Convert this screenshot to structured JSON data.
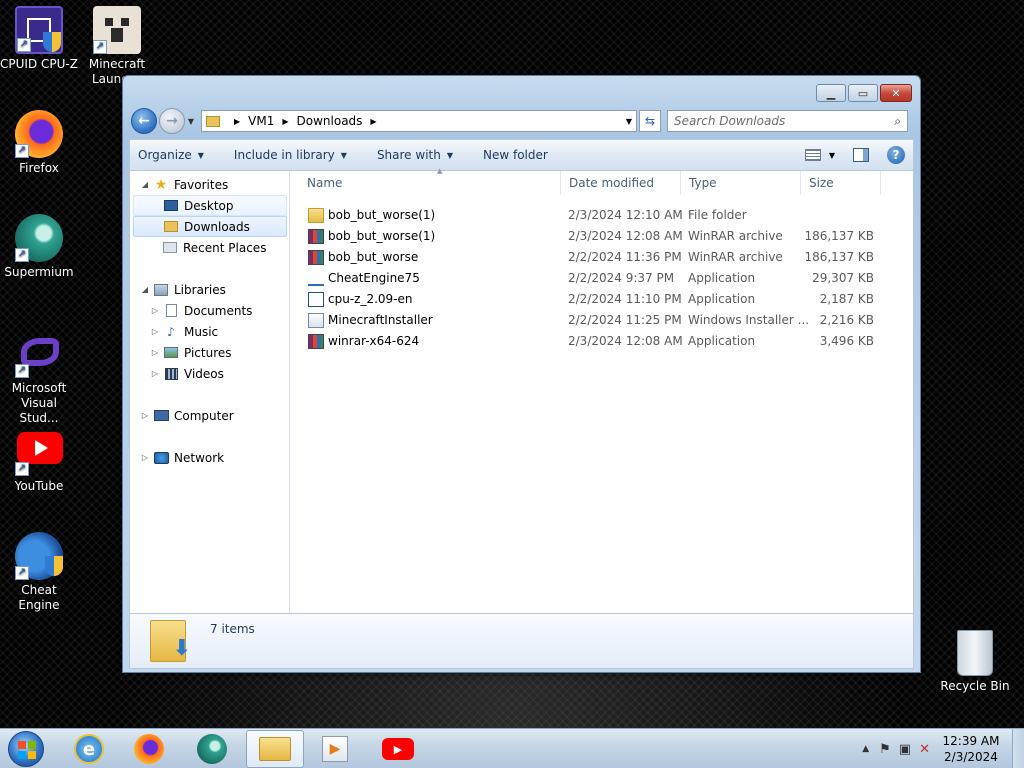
{
  "desktop": {
    "icons": [
      {
        "label1": "CPUID CPU-Z",
        "label2": ""
      },
      {
        "label1": "Minecraft",
        "label2": "Launc"
      },
      {
        "label1": "Firefox",
        "label2": ""
      },
      {
        "label1": "Supermium",
        "label2": ""
      },
      {
        "label1": "Microsoft",
        "label2": "Visual Stud..."
      },
      {
        "label1": "YouTube",
        "label2": ""
      },
      {
        "label1": "Cheat Engine",
        "label2": ""
      },
      {
        "label1": "Recycle Bin",
        "label2": ""
      }
    ]
  },
  "window": {
    "address": {
      "crumbs": [
        "VM1",
        "Downloads"
      ]
    },
    "search": {
      "placeholder": "Search Downloads"
    },
    "toolbar": {
      "organize": "Organize",
      "include_in_library": "Include in library",
      "share_with": "Share with",
      "new_folder": "New folder"
    },
    "nav": {
      "favorites": "Favorites",
      "desktop": "Desktop",
      "downloads": "Downloads",
      "recent_places": "Recent Places",
      "libraries": "Libraries",
      "documents": "Documents",
      "music": "Music",
      "pictures": "Pictures",
      "videos": "Videos",
      "computer": "Computer",
      "network": "Network"
    },
    "columns": {
      "name": "Name",
      "date_modified": "Date modified",
      "type": "Type",
      "size": "Size"
    },
    "files": [
      {
        "name": "bob_but_worse(1)",
        "date": "2/3/2024 12:10 AM",
        "type": "File folder",
        "size": "",
        "icon": "folder-icon"
      },
      {
        "name": "bob_but_worse(1)",
        "date": "2/3/2024 12:08 AM",
        "type": "WinRAR archive",
        "size": "186,137 KB",
        "icon": "rar-archive-icon"
      },
      {
        "name": "bob_but_worse",
        "date": "2/2/2024 11:36 PM",
        "type": "WinRAR archive",
        "size": "186,137 KB",
        "icon": "rar-archive-icon"
      },
      {
        "name": "CheatEngine75",
        "date": "2/2/2024 9:37 PM",
        "type": "Application",
        "size": "29,307 KB",
        "icon": "cheat-engine-installer-icon"
      },
      {
        "name": "cpu-z_2.09-en",
        "date": "2/2/2024 11:10 PM",
        "type": "Application",
        "size": "2,187 KB",
        "icon": "cpuz-installer-icon"
      },
      {
        "name": "MinecraftInstaller",
        "date": "2/2/2024 11:25 PM",
        "type": "Windows Installer ...",
        "size": "2,216 KB",
        "icon": "msi-installer-icon"
      },
      {
        "name": "winrar-x64-624",
        "date": "2/3/2024 12:08 AM",
        "type": "Application",
        "size": "3,496 KB",
        "icon": "winrar-installer-icon"
      }
    ],
    "details": {
      "count": "7 items"
    }
  },
  "taskbar": {
    "clock_time": "12:39 AM",
    "clock_date": "2/3/2024"
  }
}
